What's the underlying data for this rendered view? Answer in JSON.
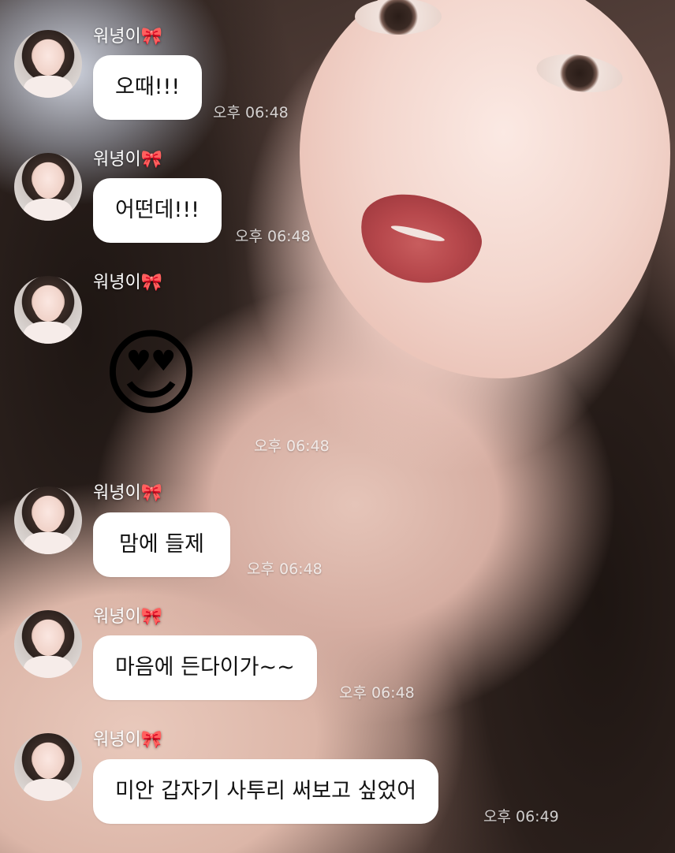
{
  "chat": {
    "messages": [
      {
        "sender": "워녕이🎀",
        "text": "오때!!!",
        "time": "오후 06:48"
      },
      {
        "sender": "워녕이🎀",
        "text": "어떤데!!!",
        "time": "오후 06:48"
      },
      {
        "sender": "워녕이🎀",
        "text": "😍",
        "time": "오후 06:48"
      },
      {
        "sender": "워녕이🎀",
        "text": "맘에 들제",
        "time": "오후 06:48"
      },
      {
        "sender": "워녕이🎀",
        "text": "마음에 든다이가~~",
        "time": "오후 06:48"
      },
      {
        "sender": "워녕이🎀",
        "text": "미안 갑자기 사투리 써보고 싶었어",
        "time": "오후 06:49"
      }
    ]
  }
}
